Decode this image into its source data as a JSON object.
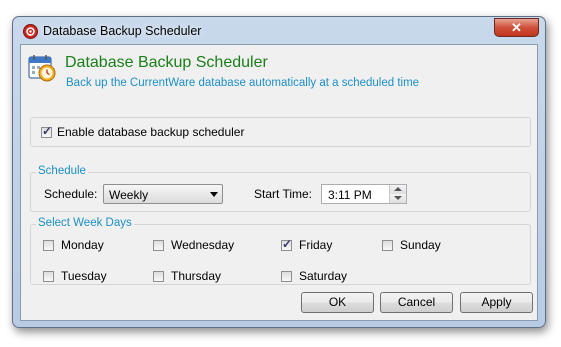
{
  "window": {
    "title": "Database Backup Scheduler",
    "close_symbol": "✕"
  },
  "header": {
    "title": "Database Backup Scheduler",
    "subtitle": "Back up the CurrentWare database automatically at a scheduled time",
    "title_color": "#1a7f1a",
    "subtitle_color": "#1d8fc5"
  },
  "enable": {
    "label": "Enable database backup scheduler",
    "checked": true
  },
  "schedule": {
    "legend": "Schedule",
    "schedule_label": "Schedule:",
    "schedule_value": "Weekly",
    "start_time_label": "Start Time:",
    "start_time_value": "3:11 PM"
  },
  "week_days": {
    "legend": "Select Week Days",
    "days": [
      {
        "label": "Monday",
        "checked": false
      },
      {
        "label": "Wednesday",
        "checked": false
      },
      {
        "label": "Friday",
        "checked": true
      },
      {
        "label": "Sunday",
        "checked": false
      },
      {
        "label": "Tuesday",
        "checked": false
      },
      {
        "label": "Thursday",
        "checked": false
      },
      {
        "label": "Saturday",
        "checked": false
      }
    ]
  },
  "buttons": {
    "ok": "OK",
    "cancel": "Cancel",
    "apply": "Apply"
  },
  "icons": {
    "app": "app-logo-icon",
    "header": "calendar-clock-icon"
  }
}
